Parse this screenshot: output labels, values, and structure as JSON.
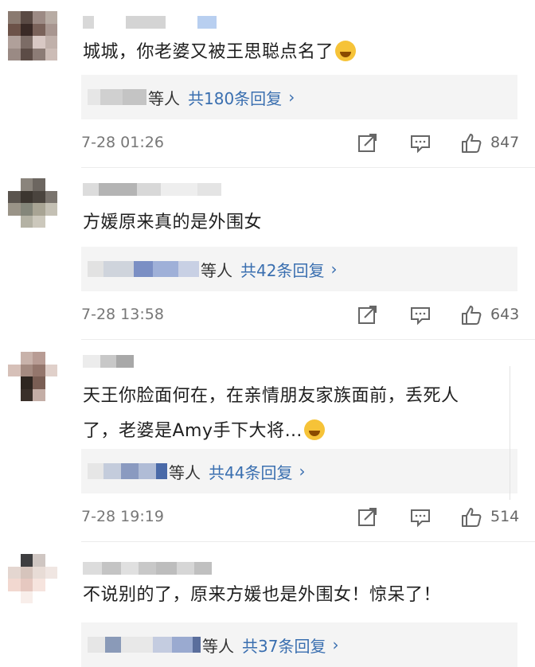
{
  "comments": [
    {
      "text": "城城，你老婆又被王思聪点名了",
      "has_emoji": true,
      "reply_who": "等人",
      "reply_count": "共180条回复",
      "arrow": "›",
      "time": "7-28 01:26",
      "likes": "847"
    },
    {
      "text": "方媛原来真的是外围女",
      "reply_who": "等人",
      "reply_count": "共42条回复",
      "arrow": "›",
      "time": "7-28 13:58",
      "likes": "643"
    },
    {
      "text": "天王你脸面何在，在亲情朋友家族面前，丢死人\n了，老婆是Amy手下大将…",
      "has_emoji": true,
      "reply_who": "等人",
      "reply_count": "共44条回复",
      "arrow": "›",
      "time": "7-28 19:19",
      "likes": "514"
    },
    {
      "text": "不说别的了，原来方媛也是外围女！惊呆了！",
      "reply_who": "等人",
      "reply_count": "共37条回复",
      "arrow": "›"
    }
  ],
  "icons": {
    "share": "share-icon",
    "comment": "comment-icon",
    "like": "thumbs-up-icon"
  },
  "colors": {
    "reply_link": "#3a6fb0",
    "meta_text": "#777777",
    "reply_bg": "#f4f4f4"
  }
}
